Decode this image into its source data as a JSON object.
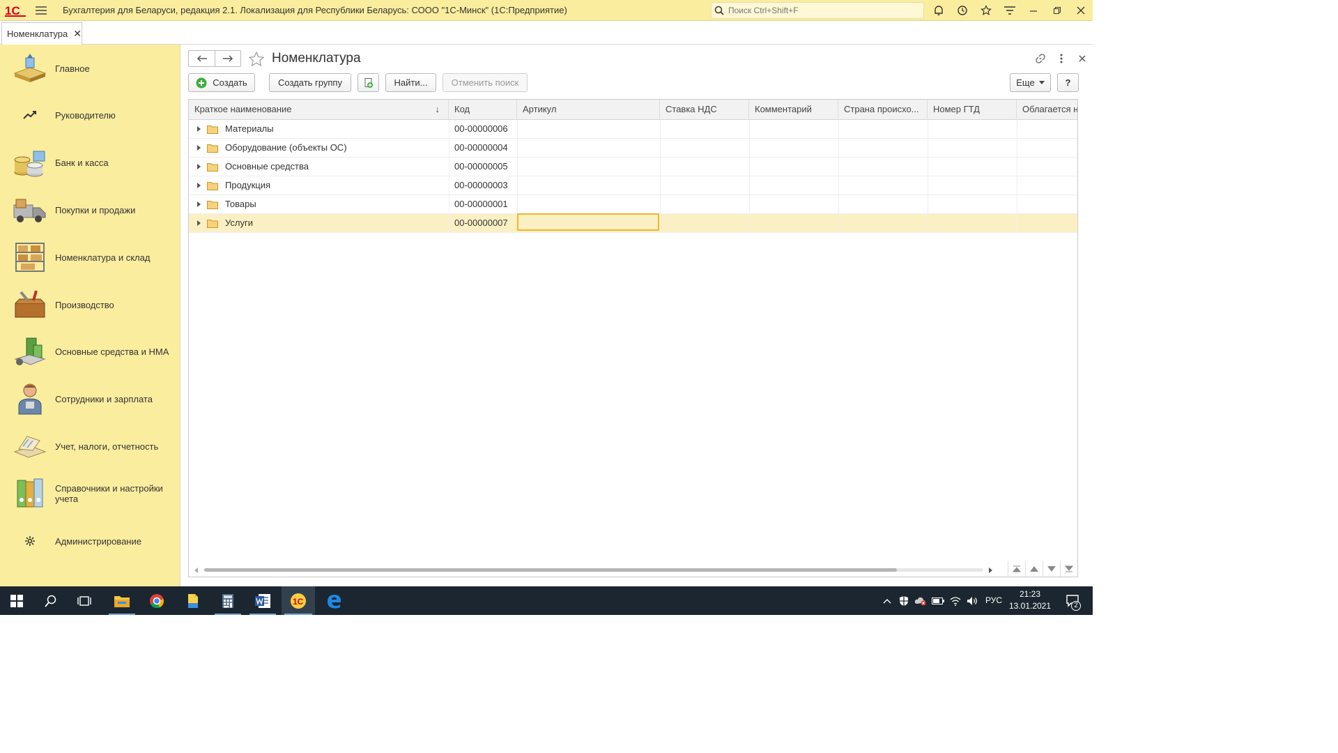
{
  "window": {
    "title": "Бухгалтерия для Беларуси, редакция 2.1. Локализация для Республики Беларусь: СООО \"1С-Минск\"  (1С:Предприятие)",
    "search_placeholder": "Поиск Ctrl+Shift+F",
    "logo_text": "1С"
  },
  "tabs": [
    {
      "label": "Номенклатура",
      "close": "✕"
    }
  ],
  "sidebar": {
    "items": [
      {
        "label": "Главное",
        "icon": "desk-icon"
      },
      {
        "label": "Руководителю",
        "icon": "trend-chart-icon"
      },
      {
        "label": "Банк и касса",
        "icon": "coins-icon"
      },
      {
        "label": "Покупки и продажи",
        "icon": "truck-icon"
      },
      {
        "label": "Номенклатура и склад",
        "icon": "warehouse-shelves-icon"
      },
      {
        "label": "Производство",
        "icon": "toolbox-icon"
      },
      {
        "label": "Основные средства и НМА",
        "icon": "assets-icon"
      },
      {
        "label": "Сотрудники и зарплата",
        "icon": "employee-icon"
      },
      {
        "label": "Учет, налоги, отчетность",
        "icon": "reports-icon"
      },
      {
        "label": "Справочники и настройки учета",
        "icon": "binders-icon"
      },
      {
        "label": "Администрирование",
        "icon": "gear-icon"
      }
    ]
  },
  "form": {
    "title": "Номенклатура",
    "buttons": {
      "create": "Создать",
      "create_group": "Создать группу",
      "find": "Найти...",
      "cancel_search": "Отменить поиск",
      "more": "Еще",
      "help": "?"
    },
    "columns": [
      "Краткое наименование",
      "Код",
      "Артикул",
      "Ставка НДС",
      "Комментарий",
      "Страна происхо...",
      "Номер ГТД",
      "Облагается н"
    ],
    "sort_indicator": "↓",
    "rows": [
      {
        "name": "Материалы",
        "code": "00-00000006"
      },
      {
        "name": "Оборудование (объекты ОС)",
        "code": "00-00000004"
      },
      {
        "name": "Основные средства",
        "code": "00-00000005"
      },
      {
        "name": "Продукция",
        "code": "00-00000003"
      },
      {
        "name": "Товары",
        "code": "00-00000001"
      },
      {
        "name": "Услуги",
        "code": "00-00000007"
      }
    ]
  },
  "taskbar": {
    "language": "РУС",
    "time": "21:23",
    "date": "13.01.2021",
    "notifications": "2"
  },
  "colors": {
    "sidebar_bg": "#fbed9e",
    "selected_row": "#fbf0c4",
    "cursor_border": "#f0b62a",
    "taskbar_bg": "#1b2630"
  }
}
